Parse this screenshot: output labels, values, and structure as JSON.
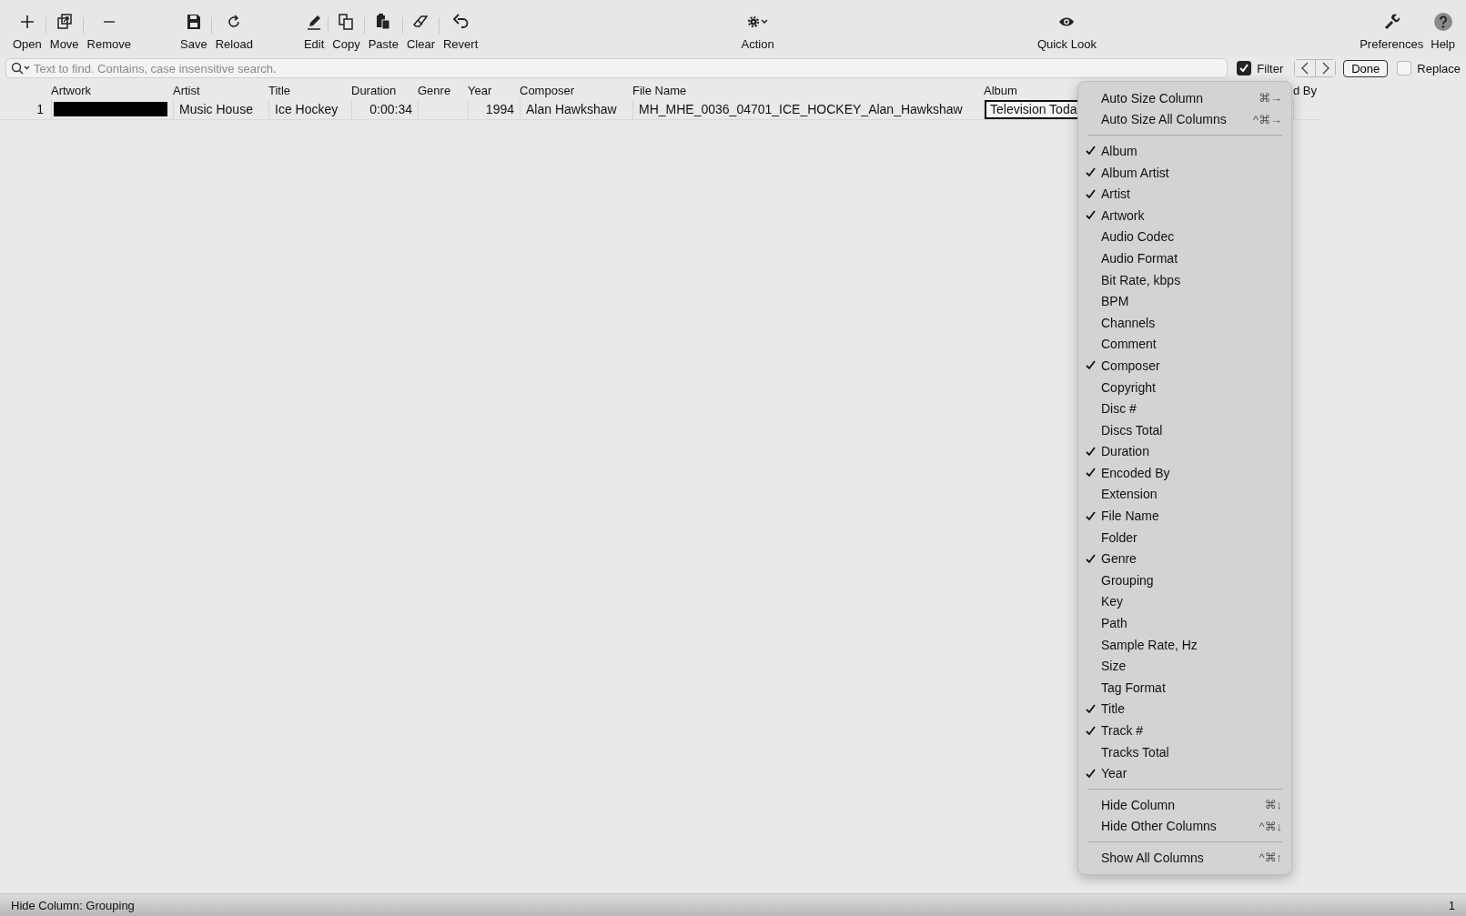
{
  "toolbar": [
    {
      "buttons": [
        {
          "label": "Open"
        },
        {
          "label": "Move"
        },
        {
          "label": "Remove"
        }
      ]
    },
    {
      "buttons": [
        {
          "label": "Save"
        },
        {
          "label": "Reload"
        }
      ]
    },
    {
      "buttons": [
        {
          "label": "Edit"
        },
        {
          "label": "Copy"
        },
        {
          "label": "Paste"
        },
        {
          "label": "Clear"
        },
        {
          "label": "Revert"
        }
      ]
    },
    {
      "buttons": [
        {
          "label": "Action"
        }
      ]
    },
    {
      "buttons": [
        {
          "label": "Quick Look"
        }
      ]
    },
    {
      "buttons": [
        {
          "label": "Preferences"
        },
        {
          "label": "Help"
        }
      ]
    }
  ],
  "search": {
    "placeholder": "Text to find. Contains, case insensitive search.",
    "filter": {
      "label": "Filter",
      "checked": true
    },
    "done": "Done",
    "replace": {
      "label": "Replace",
      "checked": false
    }
  },
  "table": {
    "columns": [
      "Artwork",
      "Artist",
      "Title",
      "Duration",
      "Genre",
      "Year",
      "Composer",
      "File Name",
      "Album",
      "d By"
    ],
    "rows": [
      {
        "number": "1",
        "cells": [
          "",
          "Music House",
          "Ice Hockey",
          "0:00:34",
          "",
          "1994",
          "Alan  Hawkshaw",
          "MH_MHE_0036_04701_ICE_HOCKEY_Alan_Hawkshaw",
          "Television Toda",
          ""
        ]
      }
    ]
  },
  "context_menu": {
    "items": [
      {
        "kind": "command",
        "label": "Auto Size Column",
        "shortcut": "⌘→"
      },
      {
        "kind": "command",
        "label": "Auto Size All Columns",
        "shortcut": "^⌘→"
      },
      {
        "kind": "separator"
      },
      {
        "kind": "column",
        "label": "Album",
        "checked": true
      },
      {
        "kind": "column",
        "label": "Album Artist",
        "checked": true
      },
      {
        "kind": "column",
        "label": "Artist",
        "checked": true
      },
      {
        "kind": "column",
        "label": "Artwork",
        "checked": true
      },
      {
        "kind": "column",
        "label": "Audio Codec",
        "checked": false
      },
      {
        "kind": "column",
        "label": "Audio Format",
        "checked": false
      },
      {
        "kind": "column",
        "label": "Bit Rate, kbps",
        "checked": false
      },
      {
        "kind": "column",
        "label": "BPM",
        "checked": false
      },
      {
        "kind": "column",
        "label": "Channels",
        "checked": false
      },
      {
        "kind": "column",
        "label": "Comment",
        "checked": false
      },
      {
        "kind": "column",
        "label": "Composer",
        "checked": true
      },
      {
        "kind": "column",
        "label": "Copyright",
        "checked": false
      },
      {
        "kind": "column",
        "label": "Disc #",
        "checked": false
      },
      {
        "kind": "column",
        "label": "Discs Total",
        "checked": false
      },
      {
        "kind": "column",
        "label": "Duration",
        "checked": true
      },
      {
        "kind": "column",
        "label": "Encoded By",
        "checked": true
      },
      {
        "kind": "column",
        "label": "Extension",
        "checked": false
      },
      {
        "kind": "column",
        "label": "File Name",
        "checked": true
      },
      {
        "kind": "column",
        "label": "Folder",
        "checked": false
      },
      {
        "kind": "column",
        "label": "Genre",
        "checked": true
      },
      {
        "kind": "column",
        "label": "Grouping",
        "checked": false
      },
      {
        "kind": "column",
        "label": "Key",
        "checked": false
      },
      {
        "kind": "column",
        "label": "Path",
        "checked": false
      },
      {
        "kind": "column",
        "label": "Sample Rate, Hz",
        "checked": false
      },
      {
        "kind": "column",
        "label": "Size",
        "checked": false
      },
      {
        "kind": "column",
        "label": "Tag Format",
        "checked": false
      },
      {
        "kind": "column",
        "label": "Title",
        "checked": true
      },
      {
        "kind": "column",
        "label": "Track #",
        "checked": true
      },
      {
        "kind": "column",
        "label": "Tracks Total",
        "checked": false
      },
      {
        "kind": "column",
        "label": "Year",
        "checked": true
      },
      {
        "kind": "separator"
      },
      {
        "kind": "command",
        "label": "Hide Column",
        "shortcut": "⌘↓"
      },
      {
        "kind": "command",
        "label": "Hide Other Columns",
        "shortcut": "^⌘↓"
      },
      {
        "kind": "separator"
      },
      {
        "kind": "command",
        "label": "Show All Columns",
        "shortcut": "^⌘↑"
      }
    ]
  },
  "status_bar": {
    "message": "Hide Column: Grouping",
    "count": "1"
  }
}
